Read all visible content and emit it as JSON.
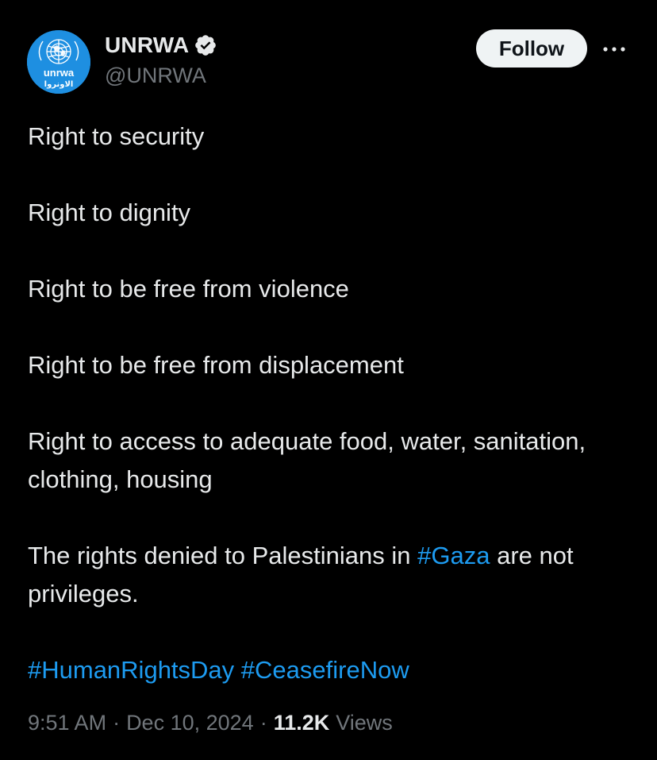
{
  "author": {
    "display_name": "UNRWA",
    "handle": "@UNRWA",
    "verified": true,
    "avatar_logo_text": "unrwa",
    "avatar_logo_text_ar": "الاونروا",
    "avatar_color": "#1e8fe1"
  },
  "actions": {
    "follow_label": "Follow",
    "more_icon": "more-horizontal-icon"
  },
  "tweet": {
    "line1": "Right to security",
    "line2": "Right to dignity",
    "line3": "Right to be free from violence",
    "line4": "Right to be free from displacement",
    "line5": "Right to access to adequate food, water, sanitation, clothing, housing",
    "line6_before": "The rights denied to Palestinians in ",
    "line6_hashtag": "#Gaza",
    "line6_after": " are not privileges.",
    "hashtag1": "#HumanRightsDay",
    "hashtag2": "#CeasefireNow"
  },
  "meta": {
    "time": "9:51 AM",
    "date": "Dec 10, 2024",
    "separator": "·",
    "views_count": "11.2K",
    "views_label": "Views"
  },
  "colors": {
    "background": "#000000",
    "text": "#e7e9ea",
    "muted": "#71767b",
    "link": "#1d9bf0",
    "follow_bg": "#eff3f4",
    "verified": "#e7e9ea"
  }
}
